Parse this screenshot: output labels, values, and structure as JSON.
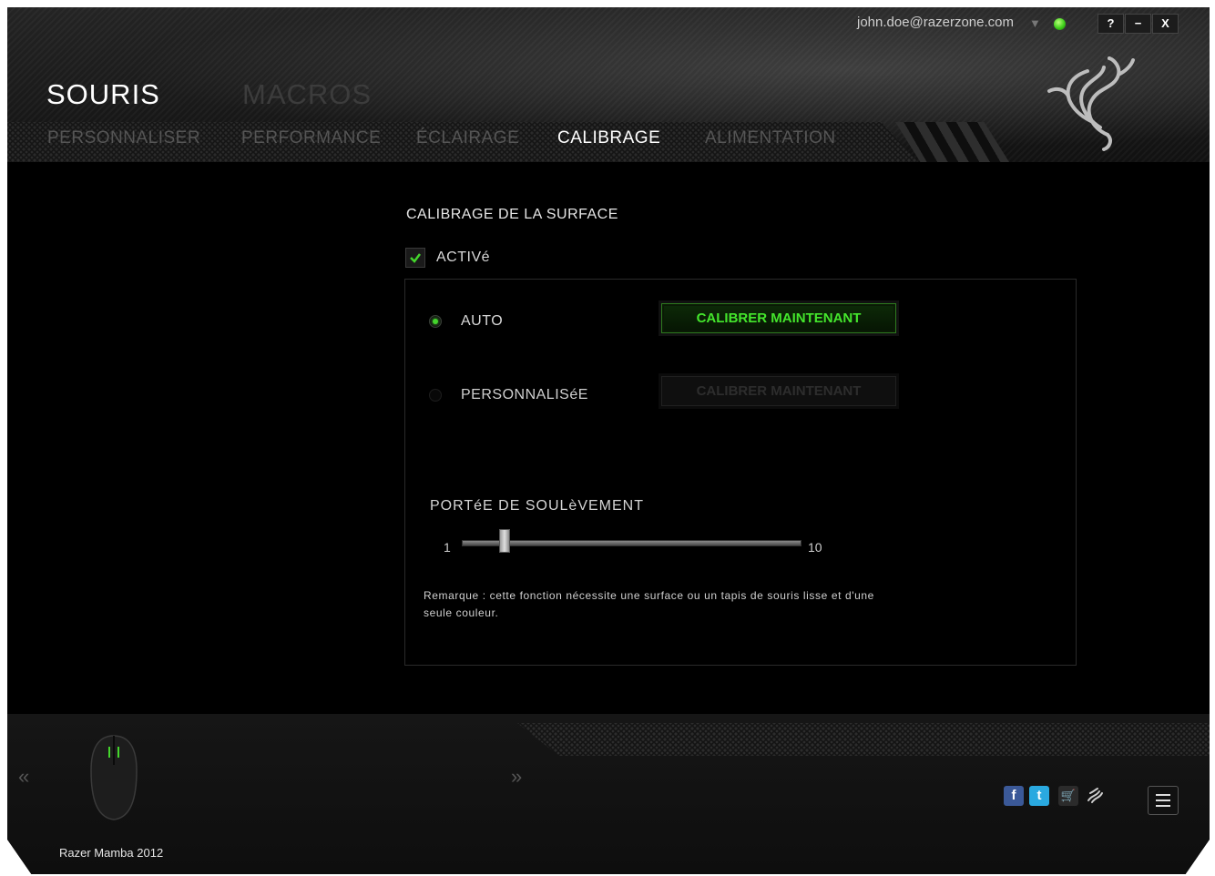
{
  "header": {
    "title_souris": "SOURIS",
    "title_macros": "MACROS",
    "account_email": "john.doe@razerzone.com",
    "window_buttons": {
      "help": "?",
      "minimize": "−",
      "close": "X"
    }
  },
  "tabs": [
    {
      "label": "PERSONNALISER",
      "active": false
    },
    {
      "label": "PERFORMANCE",
      "active": false
    },
    {
      "label": "ÉCLAIRAGE",
      "active": false
    },
    {
      "label": "CALIBRAGE",
      "active": true
    },
    {
      "label": "ALIMENTATION",
      "active": false
    }
  ],
  "calibration": {
    "section_title": "CALIBRAGE DE LA SURFACE",
    "enabled_label": "ACTIVé",
    "enabled": true,
    "auto_label": "AUTO",
    "auto_selected": true,
    "auto_button": "CALIBRER MAINTENANT",
    "custom_label": "PERSONNALISéE",
    "custom_button": "CALIBRER MAINTENANT",
    "lift_title": "PORTéE DE SOULèVEMENT",
    "slider_min": "1",
    "slider_max": "10",
    "slider_value": 2,
    "note_line1": "Remarque : cette fonction nécessite une surface ou un tapis de souris lisse et d'une",
    "note_line2": "seule couleur."
  },
  "footer": {
    "prev_arrow": "«",
    "next_arrow": "»",
    "device_name": "Razer Mamba 2012",
    "icons": [
      "facebook-icon",
      "twitter-icon",
      "cart-icon",
      "razer-icon",
      "menu-icon"
    ]
  },
  "colors": {
    "accent": "#44d62c",
    "background": "#000000"
  }
}
